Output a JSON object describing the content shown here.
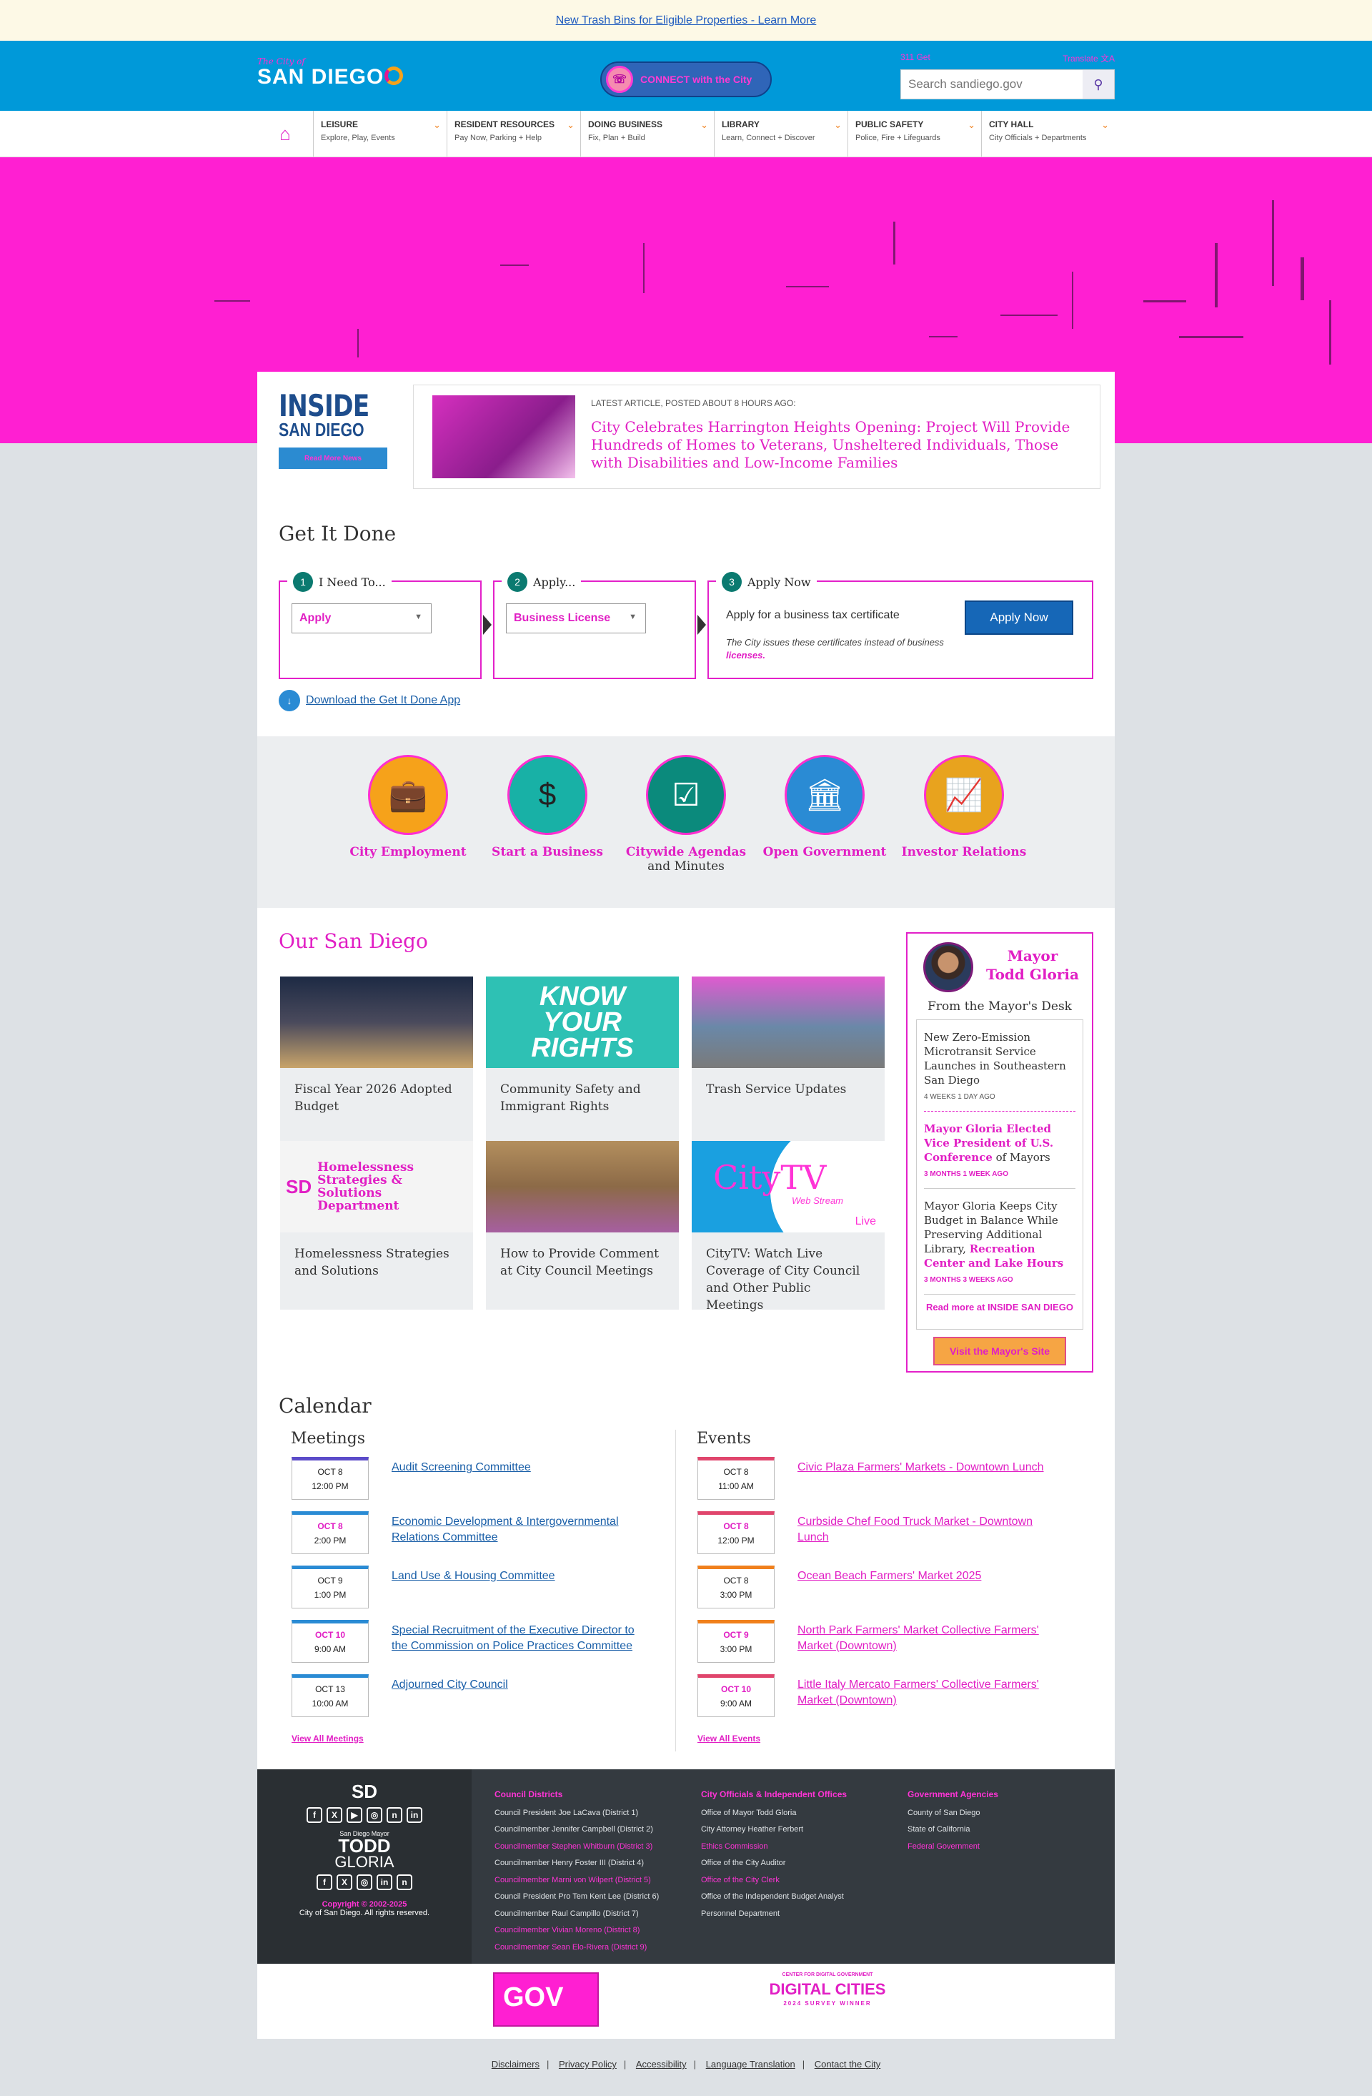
{
  "alert": {
    "text": "New Trash Bins for Eligible Properties - Learn More"
  },
  "header": {
    "logo_small": "The City of",
    "logo_main": "SAN DIEGO",
    "connect": "CONNECT with the City",
    "link_left": "311 Get",
    "translate": "Translate",
    "search_placeholder": "Search sandiego.gov"
  },
  "nav": [
    {
      "title": "LEISURE",
      "sub": "Explore, Play, Events"
    },
    {
      "title": "RESIDENT RESOURCES",
      "sub": "Pay Now, Parking + Help"
    },
    {
      "title": "DOING BUSINESS",
      "sub": "Fix, Plan + Build"
    },
    {
      "title": "LIBRARY",
      "sub": "Learn, Connect + Discover"
    },
    {
      "title": "PUBLIC SAFETY",
      "sub": "Police, Fire + Lifeguards"
    },
    {
      "title": "CITY HALL",
      "sub": "City Officials + Departments"
    }
  ],
  "inside": {
    "logo_a": "INSIDE",
    "logo_b": "SAN DIEGO",
    "btn": "Read More News",
    "meta": "LATEST ARTICLE, POSTED ABOUT 8 HOURS AGO:",
    "title": "City Celebrates Harrington Heights Opening: Project Will Provide Hundreds of Homes to Veterans, Unsheltered Individuals, Those with Disabilities and Low-Income Families"
  },
  "gid": {
    "title": "Get It Done",
    "s1": "I Need To...",
    "s1v": "Apply",
    "s2": "Apply...",
    "s2v": "Business License",
    "s3": "Apply Now",
    "s3txt": "Apply for a business tax certificate",
    "s3note_a": "The City issues these certificates instead of business",
    "s3note_b": "licenses.",
    "s3btn": "Apply Now",
    "app": "Download the Get It Done App"
  },
  "quick": [
    {
      "t": "City Employment",
      "t2": ""
    },
    {
      "t": "Start a Business",
      "t2": ""
    },
    {
      "t": "Citywide Agendas",
      "t2": "and Minutes"
    },
    {
      "t": "Open Government",
      "t2": ""
    },
    {
      "t": "Investor Relations",
      "t2": ""
    }
  ],
  "osd": {
    "title": "Our San Diego",
    "tiles": [
      {
        "t": "Fiscal Year 2026 Adopted Budget"
      },
      {
        "t": "Community Safety and Immigrant Rights",
        "img": "KNOW YOUR RIGHTS"
      },
      {
        "t": "Trash Service Updates"
      },
      {
        "t": "Homelessness Strategies and Solutions",
        "img": "Homelessness Strategies & Solutions Department"
      },
      {
        "t": "How to Provide Comment at City Council Meetings"
      },
      {
        "t": "CityTV: Watch Live Coverage of City Council and Other Public Meetings",
        "img": "CityTV",
        "img_sub": "Web Stream",
        "img_live": "Live"
      }
    ]
  },
  "mayor": {
    "name_a": "Mayor",
    "name_b": "Todd Gloria",
    "desk": "From the Mayor's Desk",
    "news": [
      {
        "t": "New Zero-Emission Microtransit Service Launches in Southeastern San Diego",
        "d": "4 WEEKS 1 DAY AGO"
      },
      {
        "t_m": "Mayor Gloria Elected Vice President of U.S. Conference",
        "t2": "of Mayors",
        "d": "3 MONTHS 1 WEEK AGO"
      },
      {
        "t": "Mayor Gloria Keeps City Budget in Balance While Preserving Additional Library,",
        "t_m": "Recreation Center and Lake Hours",
        "d": "3 MONTHS 3 WEEKS AGO"
      }
    ],
    "more": "Read more at INSIDE SAN DIEGO",
    "visit": "Visit the Mayor's Site"
  },
  "cal": {
    "title": "Calendar",
    "meet_h": "Meetings",
    "ev_h": "Events",
    "meet_all": "View All Meetings",
    "ev_all": "View All Events",
    "meetings": [
      {
        "d": "OCT 8",
        "t": "12:00 PM",
        "l": "Audit Screening Committee",
        "c": "#5b4bc9"
      },
      {
        "d": "OCT 8",
        "t": "2:00 PM",
        "l": "Economic Development & Intergovernmental Relations Committee",
        "c": "#2a8bd4"
      },
      {
        "d": "OCT 9",
        "t": "1:00 PM",
        "l": "Land Use & Housing Committee",
        "c": "#2a8bd4"
      },
      {
        "d": "OCT 10",
        "t": "9:00 AM",
        "l": "Special Recruitment of the Executive Director to the Commission on Police Practices Committee",
        "c": "#2a8bd4"
      },
      {
        "d": "OCT 13",
        "t": "10:00 AM",
        "l": "Adjourned City Council",
        "c": "#2a8bd4"
      }
    ],
    "events": [
      {
        "d": "OCT 8",
        "t": "11:00 AM",
        "l": "Civic Plaza Farmers' Markets - Downtown Lunch",
        "c": "#e0456c"
      },
      {
        "d": "OCT 8",
        "t": "12:00 PM",
        "l": "Curbside Chef Food Truck Market - Downtown Lunch",
        "c": "#e0456c"
      },
      {
        "d": "OCT 8",
        "t": "3:00 PM",
        "l": "Ocean Beach Farmers' Market 2025",
        "c": "#f0801c"
      },
      {
        "d": "OCT 9",
        "t": "3:00 PM",
        "l": "North Park Farmers' Market Collective Farmers' Market (Downtown)",
        "c": "#f0801c"
      },
      {
        "d": "OCT 10",
        "t": "9:00 AM",
        "l": "Little Italy Mercato Farmers' Collective Farmers' Market (Downtown)",
        "c": "#e0456c"
      }
    ]
  },
  "footer": {
    "copy_a": "Copyright © 2002-2025",
    "copy_b": "City of San Diego. All rights reserved.",
    "mayor_logo_a": "San Diego Mayor",
    "mayor_logo_b": "TODD",
    "mayor_logo_c": "GLORIA",
    "cols": [
      {
        "h": "Council Districts",
        "items": [
          {
            "t": "Council President Joe LaCava (District 1)"
          },
          {
            "t": "Councilmember Jennifer Campbell (District 2)"
          },
          {
            "t": "Councilmember Stephen Whitburn (District 3)",
            "m": true
          },
          {
            "t": "Councilmember Henry Foster III (District 4)"
          },
          {
            "t": "Councilmember Marni von Wilpert (District 5)",
            "m": true
          },
          {
            "t": "Council President Pro Tem Kent Lee (District 6)"
          },
          {
            "t": "Councilmember Raul Campillo (District 7)"
          },
          {
            "t": "Councilmember Vivian Moreno (District 8)",
            "m": true
          },
          {
            "t": "Councilmember Sean Elo-Rivera (District 9)",
            "m": true
          }
        ]
      },
      {
        "h": "City Officials & Independent Offices",
        "items": [
          {
            "t": "Office of Mayor Todd Gloria"
          },
          {
            "t": "City Attorney Heather Ferbert"
          },
          {
            "t": "Ethics Commission",
            "m": true
          },
          {
            "t": "Office of the City Auditor"
          },
          {
            "t": "Office of the City Clerk",
            "m": true
          },
          {
            "t": "Office of the Independent Budget Analyst"
          },
          {
            "t": "Personnel Department"
          }
        ]
      },
      {
        "h": "Government Agencies",
        "items": [
          {
            "t": "County of San Diego"
          },
          {
            "t": "State of California"
          },
          {
            "t": "Federal Government",
            "m": true
          }
        ]
      }
    ]
  },
  "awards": {
    "gov": "GOV",
    "dc_a": "CENTER FOR DIGITAL GOVERNMENT",
    "dc_b": "DIGITAL CITIES",
    "dc_c": "2024 SURVEY WINNER"
  },
  "bottom": [
    "Disclaimers",
    "Privacy Policy",
    "Accessibility",
    "Language Translation",
    "Contact the City"
  ]
}
